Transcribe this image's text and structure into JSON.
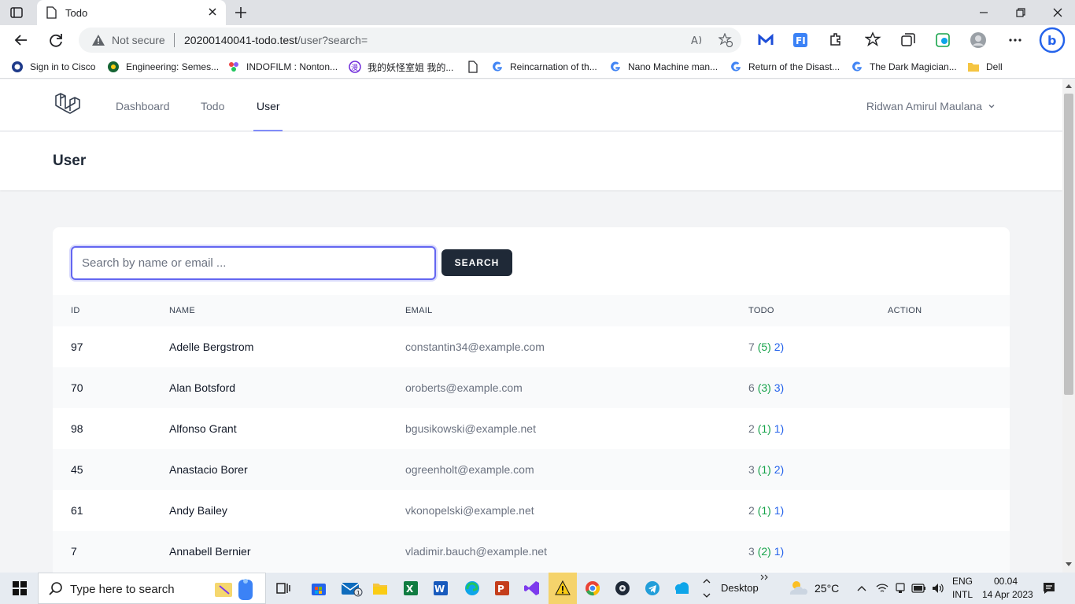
{
  "browser": {
    "tab_title": "Todo",
    "security_label": "Not secure",
    "url_host": "20200140041-todo.test",
    "url_path": "/user?search=",
    "bookmarks": [
      "Sign in to Cisco",
      "Engineering: Semes...",
      "INDOFILM : Nonton...",
      "我的妖怪室姐 我的...",
      "",
      "Reincarnation of th...",
      "Nano Machine man...",
      "Return of the Disast...",
      "The Dark Magician...",
      "Dell"
    ]
  },
  "nav": {
    "links": [
      "Dashboard",
      "Todo",
      "User"
    ],
    "user_name": "Ridwan Amirul Maulana"
  },
  "header": {
    "title": "User"
  },
  "search": {
    "placeholder": "Search by name or email ...",
    "button_label": "SEARCH"
  },
  "table": {
    "columns": [
      "ID",
      "NAME",
      "EMAIL",
      "TODO",
      "ACTION"
    ],
    "rows": [
      {
        "id": "97",
        "name": "Adelle Bergstrom",
        "email": "constantin34@example.com",
        "todo_total": "7",
        "todo_done": "(5)",
        "todo_undone": "2)"
      },
      {
        "id": "70",
        "name": "Alan Botsford",
        "email": "oroberts@example.com",
        "todo_total": "6",
        "todo_done": "(3)",
        "todo_undone": "3)"
      },
      {
        "id": "98",
        "name": "Alfonso Grant",
        "email": "bgusikowski@example.net",
        "todo_total": "2",
        "todo_done": "(1)",
        "todo_undone": "1)"
      },
      {
        "id": "45",
        "name": "Anastacio Borer",
        "email": "ogreenholt@example.com",
        "todo_total": "3",
        "todo_done": "(1)",
        "todo_undone": "2)"
      },
      {
        "id": "61",
        "name": "Andy Bailey",
        "email": "vkonopelski@example.net",
        "todo_total": "2",
        "todo_done": "(1)",
        "todo_undone": "1)"
      },
      {
        "id": "7",
        "name": "Annabell Bernier",
        "email": "vladimir.bauch@example.net",
        "todo_total": "3",
        "todo_done": "(2)",
        "todo_undone": "1)"
      }
    ]
  },
  "taskbar": {
    "search_placeholder": "Type here to search",
    "desktop_label": "Desktop",
    "weather": "25°C",
    "lang_1": "ENG",
    "lang_2": "INTL",
    "time": "00.04",
    "date": "14 Apr 2023"
  },
  "colors": {
    "accent": "#6366f1",
    "todo_done": "#16a34a",
    "todo_undone": "#2563eb",
    "button_dark": "#1f2937"
  }
}
